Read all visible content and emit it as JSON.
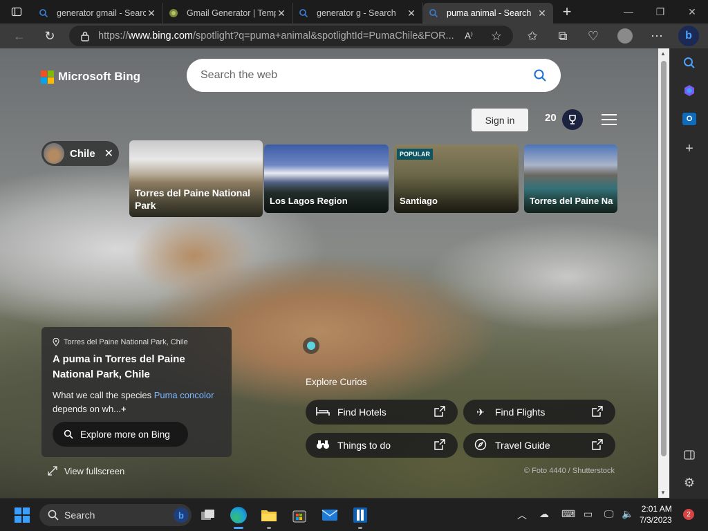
{
  "browser": {
    "tabs": [
      {
        "title": "generator gmail - Search",
        "favicon": "bing-search-icon"
      },
      {
        "title": "Gmail Generator | Temp",
        "favicon": "gmail-generator-favicon"
      },
      {
        "title": "generator g - Search",
        "favicon": "bing-search-icon"
      },
      {
        "title": "puma animal - Search",
        "favicon": "bing-search-icon",
        "active": true
      }
    ],
    "url_prefix": "https://",
    "url_host": "www.bing.com",
    "url_rest": "/spotlight?q=puma+animal&spotlightId=PumaChile&FOR..."
  },
  "page": {
    "logo_text": "Microsoft Bing",
    "search_placeholder": "Search the web",
    "signin_label": "Sign in",
    "rewards_points": "20",
    "chip_label": "Chile",
    "cards": [
      {
        "caption": "Torres del Paine National Park"
      },
      {
        "caption": "Los Lagos Region"
      },
      {
        "caption": "Santiago",
        "badge": "POPULAR"
      },
      {
        "caption": "Torres del Paine National Park"
      }
    ],
    "info": {
      "location": "Torres del Paine National Park, Chile",
      "title": "A puma in Torres del Paine National Park, Chile",
      "body_prefix": "What we call the species ",
      "body_link": "Puma concolor",
      "body_suffix": " depends on wh...",
      "more_glyph": "+",
      "explore_label": "Explore more on Bing"
    },
    "fullscreen_label": "View fullscreen",
    "curios_label": "Explore Curios",
    "curios": [
      {
        "label": "Find Hotels",
        "icon": "bed-icon"
      },
      {
        "label": "Find Flights",
        "icon": "airplane-icon"
      },
      {
        "label": "Things to do",
        "icon": "binoculars-icon"
      },
      {
        "label": "Travel Guide",
        "icon": "compass-icon"
      }
    ],
    "credit": "© Foto 4440 / Shutterstock"
  },
  "taskbar": {
    "search_label": "Search",
    "time": "2:01 AM",
    "date": "7/3/2023",
    "notification_count": "2"
  },
  "colors": {
    "bing_blue": "#0f6cbd",
    "accent_teal": "#5ed3e0",
    "link": "#7fb7ff"
  }
}
